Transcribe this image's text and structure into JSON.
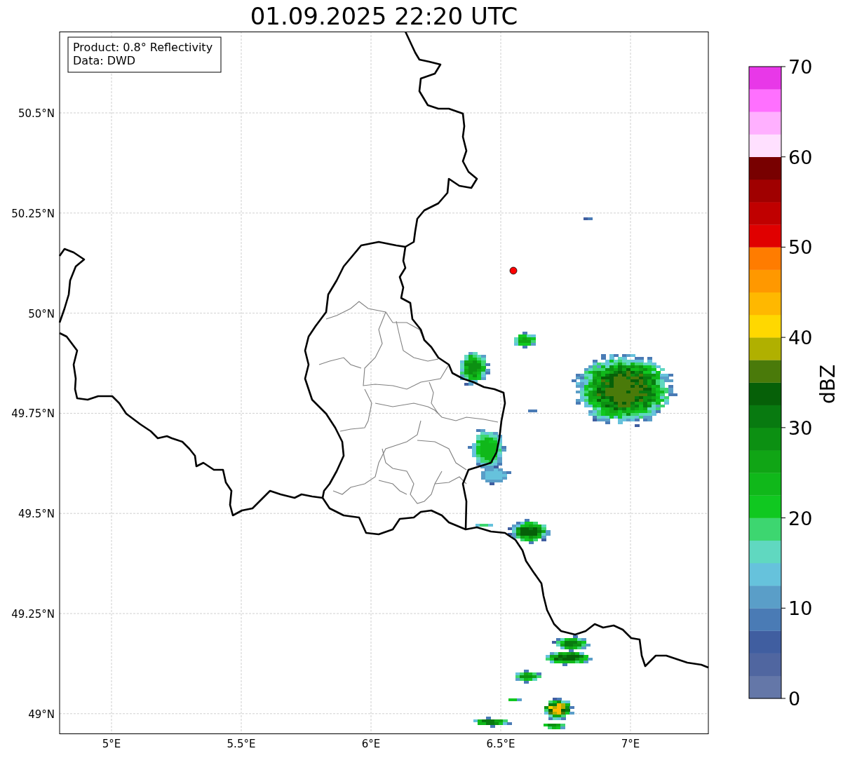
{
  "title": "01.09.2025 22:20 UTC",
  "info_box": {
    "lines": [
      "Product: 0.8° Reflectivity",
      "Data: DWD"
    ]
  },
  "map": {
    "xticks": [
      "5°E",
      "5.5°E",
      "6°E",
      "6.5°E",
      "7°E"
    ],
    "yticks": [
      "50.5°N",
      "50.25°N",
      "50°N",
      "49.75°N",
      "49.5°N",
      "49.25°N",
      "49°N"
    ],
    "site_marker": {
      "color": "#ff0000"
    }
  },
  "colorbar": {
    "label": "dBZ",
    "ticks": [
      "70",
      "60",
      "50",
      "40",
      "30",
      "20",
      "10",
      "0"
    ],
    "bins": [
      {
        "color": "#6477a8"
      },
      {
        "color": "#5066a0"
      },
      {
        "color": "#405ea0"
      },
      {
        "color": "#4a7bb5"
      },
      {
        "color": "#5a9ec8"
      },
      {
        "color": "#66c2dc"
      },
      {
        "color": "#60d8c0"
      },
      {
        "color": "#3dd670"
      },
      {
        "color": "#10c820"
      },
      {
        "color": "#10b81a"
      },
      {
        "color": "#10a515"
      },
      {
        "color": "#0c9012"
      },
      {
        "color": "#087a10"
      },
      {
        "color": "#066008"
      },
      {
        "color": "#4a7a0a"
      },
      {
        "color": "#b0b000"
      },
      {
        "color": "#ffd800"
      },
      {
        "color": "#ffb800"
      },
      {
        "color": "#ff9800"
      },
      {
        "color": "#ff7c00"
      },
      {
        "color": "#e00000"
      },
      {
        "color": "#c00000"
      },
      {
        "color": "#a00000"
      },
      {
        "color": "#780000"
      },
      {
        "color": "#ffe0ff"
      },
      {
        "color": "#ffb0ff"
      },
      {
        "color": "#ff70ff"
      },
      {
        "color": "#e838e8"
      }
    ]
  }
}
